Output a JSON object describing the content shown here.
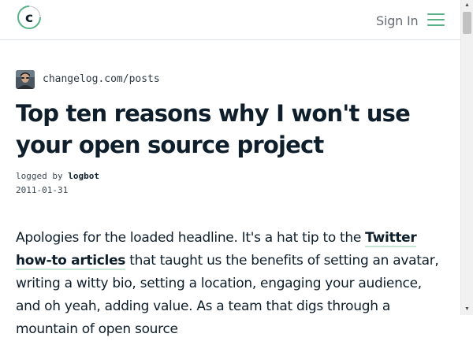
{
  "header": {
    "logo_letter": "c",
    "sign_in_label": "Sign In"
  },
  "post": {
    "source_url": "changelog.com/posts",
    "title": "Top ten reasons why I won't use your open source project",
    "meta": {
      "logged_by_label": "logged by",
      "author": "logbot",
      "date": "2011-01-31"
    },
    "body": {
      "intro": "Apologies for the loaded headline. It's a hat tip to the ",
      "link_text": "Twitter how-to articles",
      "rest": " that taught us the benefits of setting an avatar, writing a witty bio, setting a location, engaging your audience, and oh yeah, adding value. As a team that digs through a mountain of open source"
    }
  },
  "colors": {
    "accent": "#59b287",
    "text": "#0f1e2b"
  }
}
